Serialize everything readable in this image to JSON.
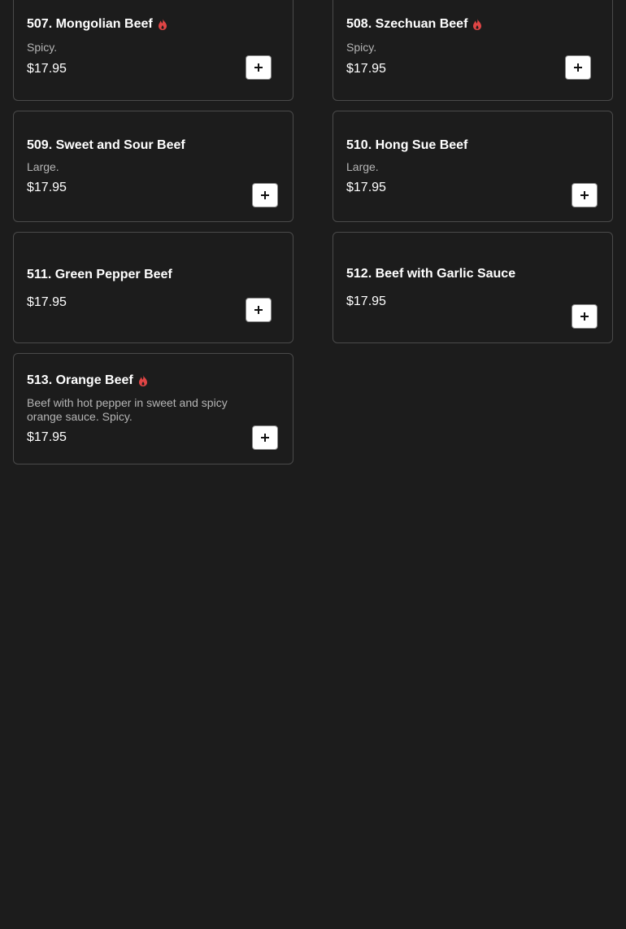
{
  "items": [
    {
      "name": "507. Mongolian Beef",
      "spicy": true,
      "description": "Spicy.",
      "price": "$17.95"
    },
    {
      "name": "508. Szechuan Beef",
      "spicy": true,
      "description": "Spicy.",
      "price": "$17.95"
    },
    {
      "name": "509. Sweet and Sour Beef",
      "spicy": false,
      "description": "Large.",
      "price": "$17.95"
    },
    {
      "name": "510. Hong Sue Beef",
      "spicy": false,
      "description": "Large.",
      "price": "$17.95"
    },
    {
      "name": "511. Green Pepper Beef",
      "spicy": false,
      "description": "",
      "price": "$17.95"
    },
    {
      "name": "512. Beef with Garlic Sauce",
      "spicy": false,
      "description": "",
      "price": "$17.95"
    },
    {
      "name": "513. Orange Beef",
      "spicy": true,
      "description": "Beef with hot pepper in sweet and spicy orange sauce. Spicy.",
      "price": "$17.95"
    }
  ],
  "colors": {
    "background": "#1c1c1c",
    "card_border": "#4a4a4a",
    "spicy_icon": "#e04545",
    "add_button": "#ffffff"
  },
  "icons": {
    "spicy": "flame-icon",
    "add": "plus-icon"
  }
}
